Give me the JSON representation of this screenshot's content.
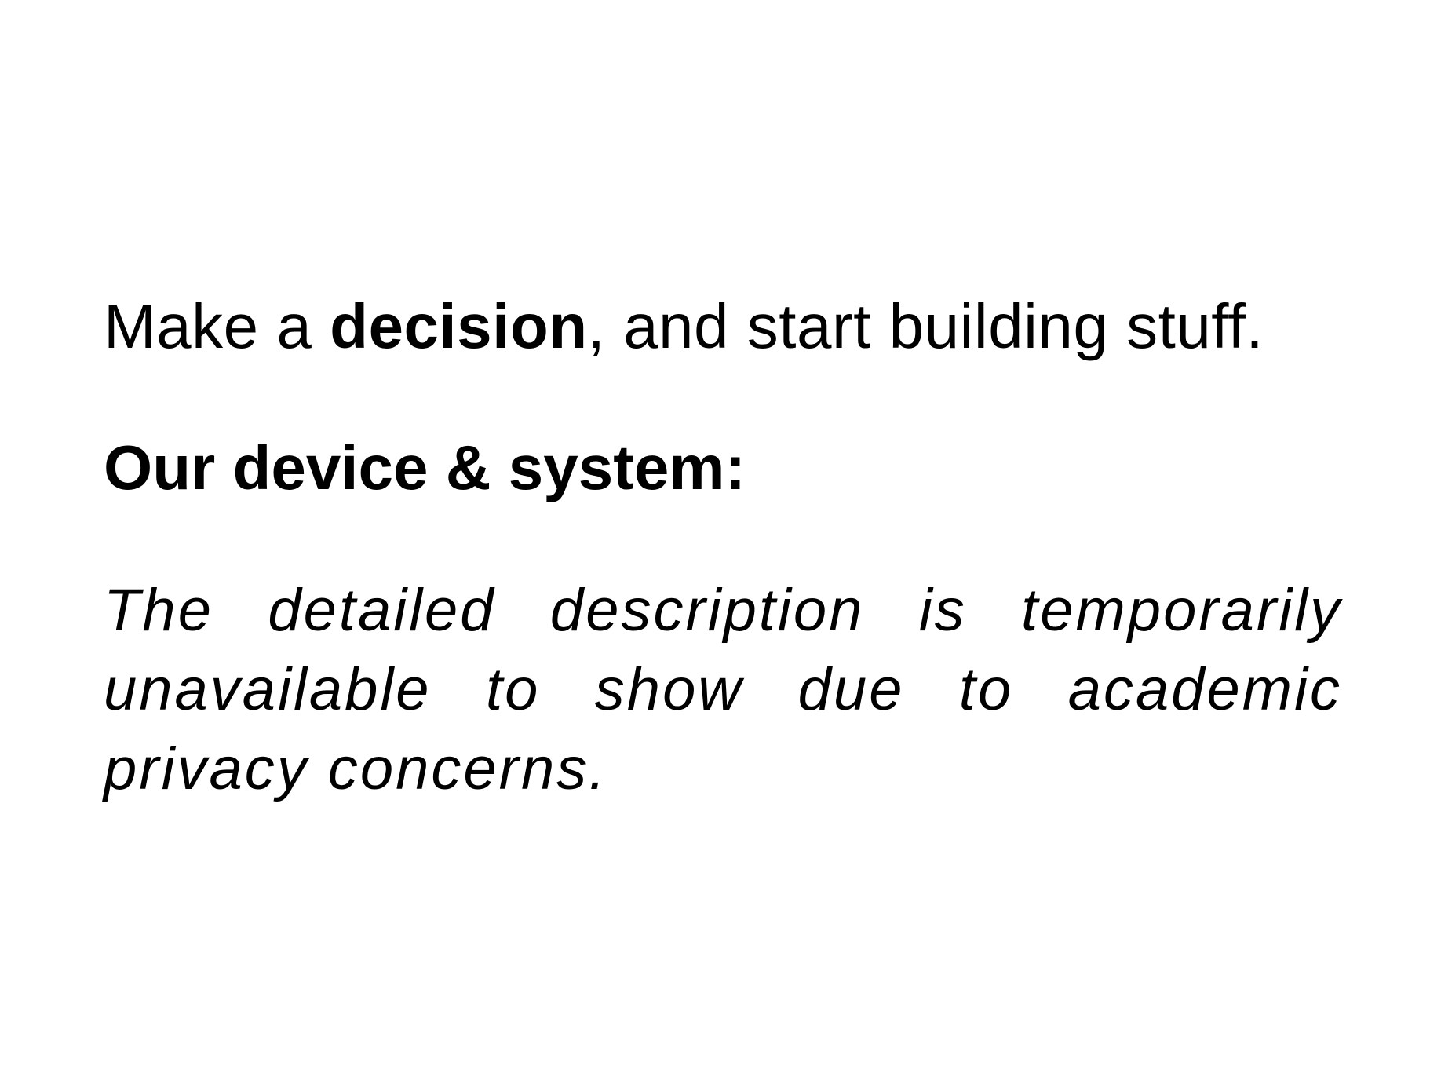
{
  "slide": {
    "line1": {
      "before": "Make a ",
      "emphasis": "decision",
      "after": ", and start building stuff."
    },
    "heading": "Our device & system:",
    "description": "The detailed description is temporarily unavailable to show due to academic privacy concerns."
  }
}
